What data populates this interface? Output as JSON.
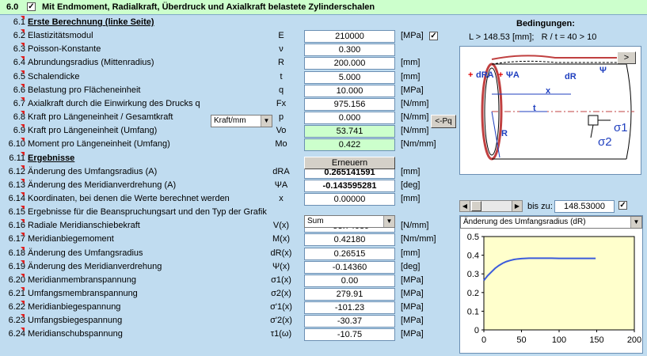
{
  "header": {
    "number": "6.0",
    "checked": "✓",
    "title": "Mit Endmoment, Radialkraft, Überdruck und Axialkraft belastete Zylinderschalen"
  },
  "rows": [
    {
      "num": "6.1",
      "label": "Erste Berechnung (linke Seite)",
      "section": true
    },
    {
      "num": "6.2",
      "label": "Elastizitätsmodul",
      "sym": "E",
      "value": "210000",
      "unit": "[MPa]"
    },
    {
      "num": "6.3",
      "label": "Poisson-Konstante",
      "sym": "ν",
      "value": "0.300",
      "unit": ""
    },
    {
      "num": "6.4",
      "label": "Abrundungsradius (Mittenradius)",
      "sym": "R",
      "value": "200.000",
      "unit": "[mm]"
    },
    {
      "num": "6.5",
      "label": "Schalendicke",
      "sym": "t",
      "value": "5.000",
      "unit": "[mm]"
    },
    {
      "num": "6.6",
      "label": "Belastung pro Flächeneinheit",
      "sym": "q",
      "value": "10.000",
      "unit": "[MPa]"
    },
    {
      "num": "6.7",
      "label": "Axialkraft durch die Einwirkung des Drucks q",
      "sym": "Fx",
      "value": "975.156",
      "unit": "[N/mm]"
    },
    {
      "num": "6.8",
      "label": "Kraft pro Längeneinheit / Gesamtkraft",
      "sym": "p",
      "value": "0.000",
      "unit": "[N/mm]"
    },
    {
      "num": "6.9",
      "label": "Kraft pro Längeneinheit (Umfang)",
      "sym": "Vo",
      "value": "53.741",
      "unit": "[N/mm]",
      "green": true
    },
    {
      "num": "6.10",
      "label": "Moment pro Längeneinheit (Umfang)",
      "sym": "Mo",
      "value": "0.422",
      "unit": "[Nm/mm]",
      "green": true
    },
    {
      "num": "6.11",
      "label": "Ergebnisse",
      "section": true
    },
    {
      "num": "6.12",
      "label": "Änderung des Umfangsradius (A)",
      "sym": "dRA",
      "value": "0.265141591",
      "unit": "[mm]",
      "bold": true
    },
    {
      "num": "6.13",
      "label": "Änderung des Meridianverdrehung (A)",
      "sym": "ΨA",
      "value": "-0.143595281",
      "unit": "[deg]",
      "bold": true
    },
    {
      "num": "6.14",
      "label": "Koordinaten, bei denen die Werte berechnet werden",
      "sym": "x",
      "value": "0.00000",
      "unit": "[mm]"
    },
    {
      "num": "6.15",
      "label": "Ergebnisse für die Beanspruchungsart und den Typ der Grafik",
      "sym": "",
      "value": "",
      "unit": ""
    },
    {
      "num": "6.16",
      "label": "Radiale Meridianschiebekraft",
      "sym": "V(x)",
      "value": "-53.74089",
      "unit": "[N/mm]"
    },
    {
      "num": "6.17",
      "label": "Meridianbiegemoment",
      "sym": "M(x)",
      "value": "0.42180",
      "unit": "[Nm/mm]"
    },
    {
      "num": "6.18",
      "label": "Änderung des Umfangsradius",
      "sym": "dR(x)",
      "value": "0.26515",
      "unit": "[mm]"
    },
    {
      "num": "6.19",
      "label": "Änderung des Meridianverdrehung",
      "sym": "Ψ(x)",
      "value": "-0.14360",
      "unit": "[deg]"
    },
    {
      "num": "6.20",
      "label": "Meridianmembranspannung",
      "sym": "σ1(x)",
      "value": "0.00",
      "unit": "[MPa]"
    },
    {
      "num": "6.21",
      "label": "Umfangsmembranspannung",
      "sym": "σ2(x)",
      "value": "279.91",
      "unit": "[MPa]"
    },
    {
      "num": "6.22",
      "label": "Meridianbiegespannung",
      "sym": "σ'1(x)",
      "value": "-101.23",
      "unit": "[MPa]"
    },
    {
      "num": "6.23",
      "label": "Umfangsbiegespannung",
      "sym": "σ'2(x)",
      "value": "-30.37",
      "unit": "[MPa]"
    },
    {
      "num": "6.24",
      "label": "Meridianschubspannung",
      "sym": "τ1(ω)",
      "value": "-10.75",
      "unit": "[MPa]"
    }
  ],
  "controls": {
    "force_mode": "Kraft/mm",
    "pq_button": "<-Pq",
    "renew_button": "Erneuern",
    "result_type": "Sum",
    "e_checkbox": "✓",
    "bis_label": "bis zu:",
    "bis_value": "148.53000",
    "bis_checkbox": "✓"
  },
  "conditions": {
    "title": "Bedingungen:",
    "text": "L > 148.53 [mm];   R / t = 40 > 10",
    "next_button": ">"
  },
  "diagram_labels": {
    "dRA": "dRA",
    "psiA": "ΨA",
    "dR": "dR",
    "psi": "Ψ",
    "x": "x",
    "t": "t",
    "R": "R",
    "sigma1": "σ1",
    "sigma2": "σ2",
    "plus": "+"
  },
  "chart_data": {
    "type": "line",
    "title": "Änderung des Umfangsradius (dR)",
    "x": [
      0,
      5,
      10,
      15,
      20,
      25,
      30,
      35,
      40,
      45,
      50,
      55,
      60,
      70,
      80,
      90,
      100,
      110,
      120,
      130,
      140,
      148.53
    ],
    "y": [
      0.265,
      0.29,
      0.31,
      0.33,
      0.345,
      0.357,
      0.366,
      0.372,
      0.377,
      0.38,
      0.382,
      0.383,
      0.384,
      0.384,
      0.384,
      0.384,
      0.383,
      0.383,
      0.383,
      0.383,
      0.383,
      0.383
    ],
    "xlim": [
      0,
      200
    ],
    "ylim": [
      0,
      0.5
    ],
    "xticks": [
      0,
      50,
      100,
      150,
      200
    ],
    "yticks": [
      0,
      0.1,
      0.2,
      0.3,
      0.4,
      0.5
    ],
    "grid": false,
    "plot_bg": "#ffffcc",
    "line_color": "#3b5bdb"
  }
}
